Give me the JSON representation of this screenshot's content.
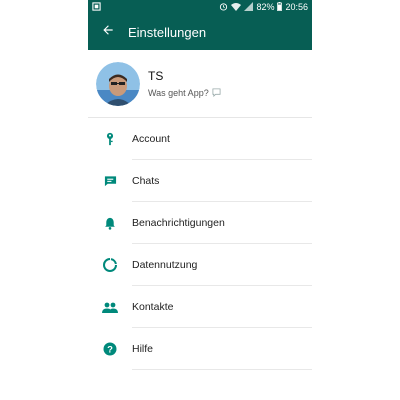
{
  "status_bar": {
    "battery": "82%",
    "time": "20:56",
    "icons": [
      "screenshot-icon",
      "alarm-icon",
      "wifi-icon",
      "signal-icon",
      "battery-icon"
    ]
  },
  "app_bar": {
    "title": "Einstellungen",
    "back_icon": "arrow-left-icon",
    "color": "#075e54"
  },
  "profile": {
    "name": "TS",
    "status": "Was geht App?"
  },
  "accent_color": "#00897b",
  "menu": {
    "items": [
      {
        "label": "Account",
        "icon": "key-icon"
      },
      {
        "label": "Chats",
        "icon": "chat-icon"
      },
      {
        "label": "Benachrichtigungen",
        "icon": "bell-icon"
      },
      {
        "label": "Datennutzung",
        "icon": "data-usage-icon"
      },
      {
        "label": "Kontakte",
        "icon": "contacts-icon"
      },
      {
        "label": "Hilfe",
        "icon": "help-icon"
      }
    ]
  }
}
